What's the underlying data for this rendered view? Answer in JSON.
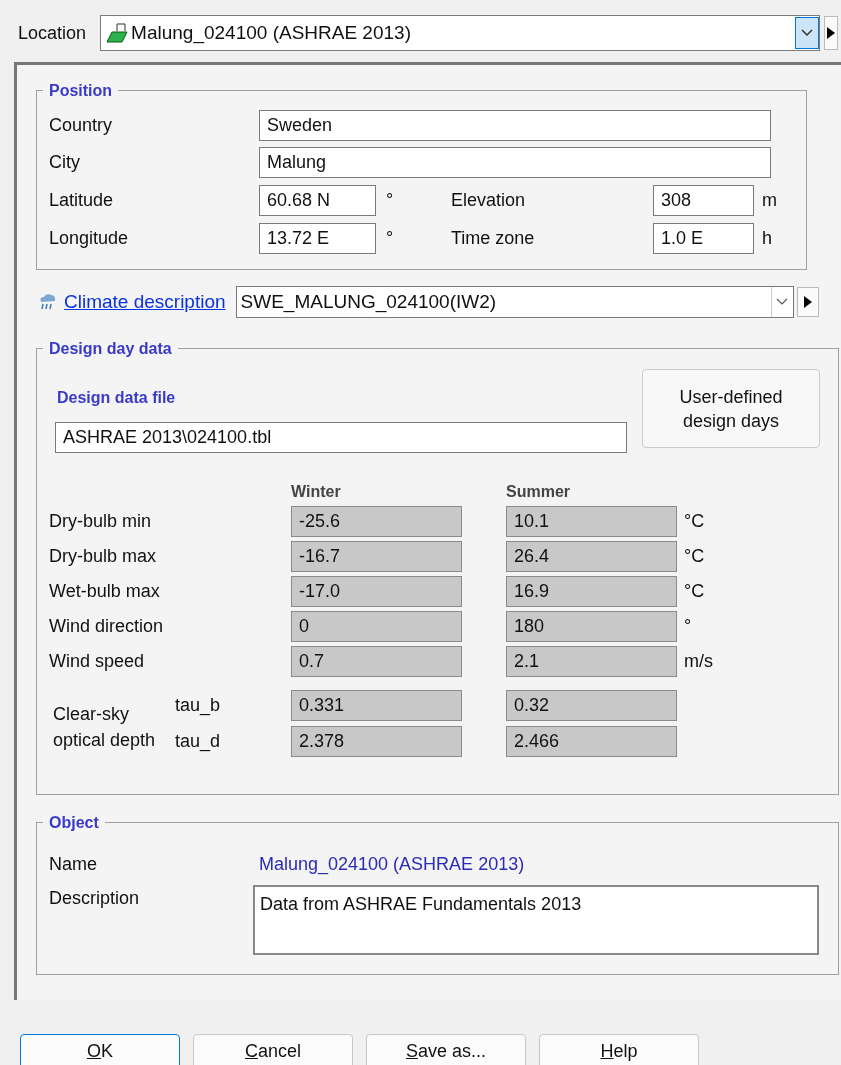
{
  "location": {
    "label": "Location",
    "value": "Malung_024100 (ASHRAE 2013)"
  },
  "position": {
    "title": "Position",
    "country": {
      "label": "Country",
      "value": "Sweden"
    },
    "city": {
      "label": "City",
      "value": "Malung"
    },
    "latitude": {
      "label": "Latitude",
      "value": "60.68 N",
      "unit": "°"
    },
    "longitude": {
      "label": "Longitude",
      "value": "13.72 E",
      "unit": "°"
    },
    "elevation": {
      "label": "Elevation",
      "value": "308",
      "unit": "m"
    },
    "time_zone": {
      "label": "Time zone",
      "value": "1.0 E",
      "unit": "h"
    }
  },
  "climate": {
    "link": "Climate description",
    "value": "SWE_MALUNG_024100(IW2)"
  },
  "design_day": {
    "title": "Design day data",
    "file_label": "Design data file",
    "file": "ASHRAE 2013\\024100.tbl",
    "user_button": "User-defined design days",
    "columns": [
      "Winter",
      "Summer"
    ],
    "rows": [
      {
        "label": "Dry-bulb min",
        "winter": "-25.6",
        "summer": "10.1",
        "unit": "°C"
      },
      {
        "label": "Dry-bulb max",
        "winter": "-16.7",
        "summer": "26.4",
        "unit": "°C"
      },
      {
        "label": "Wet-bulb max",
        "winter": "-17.0",
        "summer": "16.9",
        "unit": "°C"
      },
      {
        "label": "Wind direction",
        "winter": "0",
        "summer": "180",
        "unit": "°"
      },
      {
        "label": "Wind speed",
        "winter": "0.7",
        "summer": "2.1",
        "unit": "m/s"
      }
    ],
    "optical": {
      "label": "Clear-sky optical depth",
      "rows": [
        {
          "label": "tau_b",
          "winter": "0.331",
          "summer": "0.32"
        },
        {
          "label": "tau_d",
          "winter": "2.378",
          "summer": "2.466"
        }
      ]
    }
  },
  "object": {
    "title": "Object",
    "name_label": "Name",
    "name": "Malung_024100 (ASHRAE 2013)",
    "description_label": "Description",
    "description": "Data from ASHRAE Fundamentals 2013"
  },
  "buttons": [
    {
      "key": "O",
      "rest": "K",
      "default": true
    },
    {
      "key": "C",
      "rest": "ancel",
      "default": false
    },
    {
      "key": "S",
      "rest": "ave as...",
      "default": false
    },
    {
      "key": "H",
      "rest": "elp",
      "default": false
    }
  ]
}
